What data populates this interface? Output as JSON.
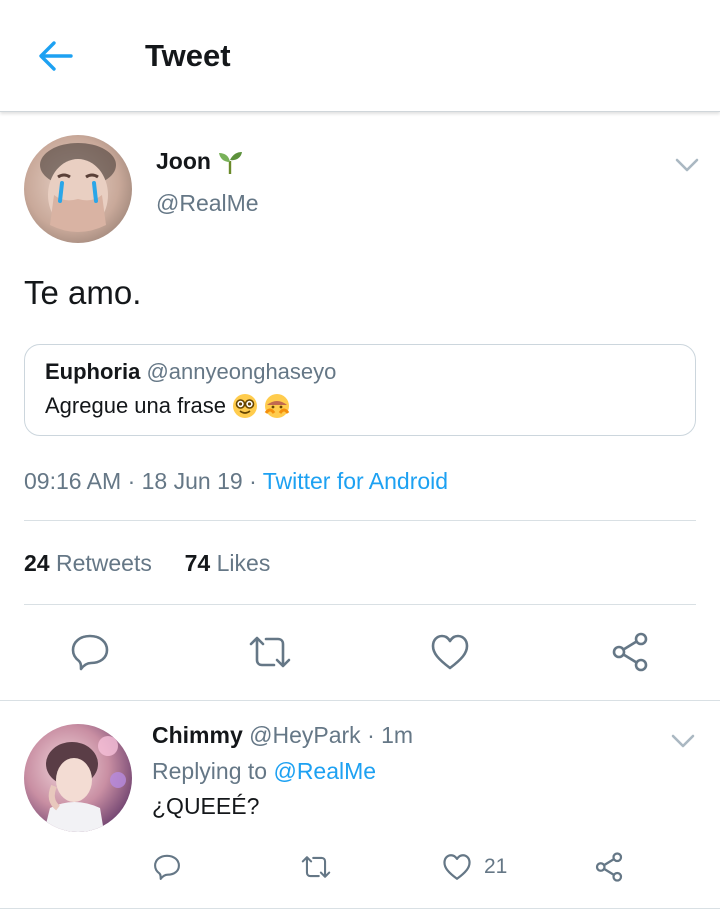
{
  "header": {
    "title": "Tweet"
  },
  "tweet": {
    "author_name": "Joon",
    "author_handle": "@RealMe",
    "text": "Te amo.",
    "quote": {
      "name": "Euphoria",
      "handle": "@annyeonghaseyo",
      "text": "Agregue una frase"
    },
    "time": "09:16 AM",
    "date": "18 Jun 19",
    "source": "Twitter for Android",
    "retweets_count": "24",
    "retweets_label": "Retweets",
    "likes_count": "74",
    "likes_label": "Likes"
  },
  "reply": {
    "name": "Chimmy",
    "handle": "@HeyPark",
    "time": "1m",
    "replying_prefix": "Replying to",
    "replying_handle": "@RealMe",
    "text": "¿QUEEÉ?",
    "like_count": "21"
  },
  "icons": {
    "back": "arrow-left-icon",
    "caret": "chevron-down-icon",
    "reply": "comment-icon",
    "retweet": "retweet-icon",
    "like": "heart-icon",
    "share": "share-icon",
    "name_emoji": "seedling-icon"
  },
  "colors": {
    "accent": "#1da1f2",
    "muted": "#657786",
    "text": "#14171a",
    "border": "#ccd6dd"
  }
}
